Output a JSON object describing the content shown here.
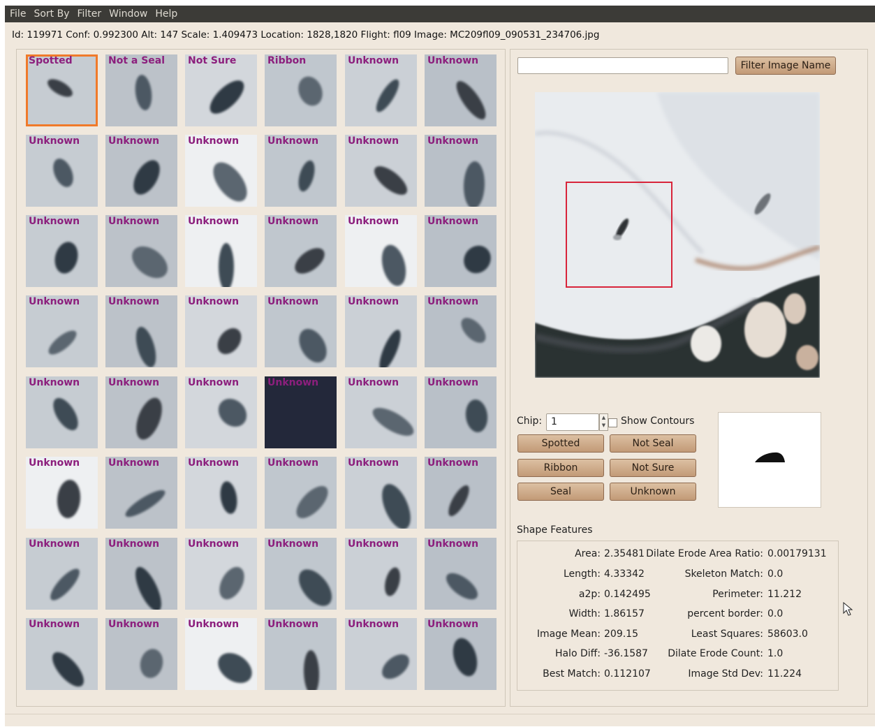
{
  "menu": [
    "File",
    "Sort By",
    "Filter",
    "Window",
    "Help"
  ],
  "info_line": "Id: 119971 Conf: 0.992300 Alt: 147 Scale: 1.409473   Location: 1828,1820   Flight: fl09 Image: MC209fl09_090531_234706.jpg",
  "tiles": [
    [
      "Spotted",
      "Not a Seal",
      "Not Sure",
      "Ribbon",
      "Unknown",
      "Unknown"
    ],
    [
      "Unknown",
      "Unknown",
      "Unknown",
      "Unknown",
      "Unknown",
      "Unknown"
    ],
    [
      "Unknown",
      "Unknown",
      "Unknown",
      "Unknown",
      "Unknown",
      "Unknown"
    ],
    [
      "Unknown",
      "Unknown",
      "Unknown",
      "Unknown",
      "Unknown",
      "Unknown"
    ],
    [
      "Unknown",
      "Unknown",
      "Unknown",
      "Unknown",
      "Unknown",
      "Unknown"
    ],
    [
      "Unknown",
      "Unknown",
      "Unknown",
      "Unknown",
      "Unknown",
      "Unknown"
    ],
    [
      "Unknown",
      "Unknown",
      "Unknown",
      "Unknown",
      "Unknown",
      "Unknown"
    ],
    [
      "Unknown",
      "Unknown",
      "Unknown",
      "Unknown",
      "Unknown",
      "Unknown"
    ]
  ],
  "filter": {
    "input_value": "",
    "button": "Filter Image Name"
  },
  "chip": {
    "label": "Chip:",
    "value": "1"
  },
  "show_contours": {
    "label": "Show Contours",
    "checked": false
  },
  "class_buttons": {
    "spotted": "Spotted",
    "not_seal": "Not Seal",
    "ribbon": "Ribbon",
    "not_sure": "Not Sure",
    "seal": "Seal",
    "unknown": "Unknown"
  },
  "shape_features": {
    "title": "Shape Features",
    "left": [
      {
        "label": "Area:",
        "value": "2.35481"
      },
      {
        "label": "Length:",
        "value": "4.33342"
      },
      {
        "label": "a2p:",
        "value": "0.142495"
      },
      {
        "label": "Width:",
        "value": "1.86157"
      },
      {
        "label": "Image Mean:",
        "value": "209.15"
      },
      {
        "label": "Halo Diff:",
        "value": "-36.1587"
      },
      {
        "label": "Best Match:",
        "value": "0.112107"
      }
    ],
    "right": [
      {
        "label": "Dilate Erode Area Ratio:",
        "value": "0.00179131"
      },
      {
        "label": "Skeleton Match:",
        "value": "0.0"
      },
      {
        "label": "Perimeter:",
        "value": "11.212"
      },
      {
        "label": "percent border:",
        "value": "0.0"
      },
      {
        "label": "Least Squares:",
        "value": "58603.0"
      },
      {
        "label": "Dilate Erode Count:",
        "value": "1.0"
      },
      {
        "label": "Image Std Dev:",
        "value": "11.224"
      }
    ]
  },
  "colors": {
    "label_purple": "#8c1f7d",
    "selection_orange": "#f07a2a",
    "detection_red": "#d8243a",
    "button_tan": "#c9a07c"
  },
  "icons": {
    "spinner": "spin-arrows-icon",
    "cursor": "mouse-pointer-icon"
  }
}
